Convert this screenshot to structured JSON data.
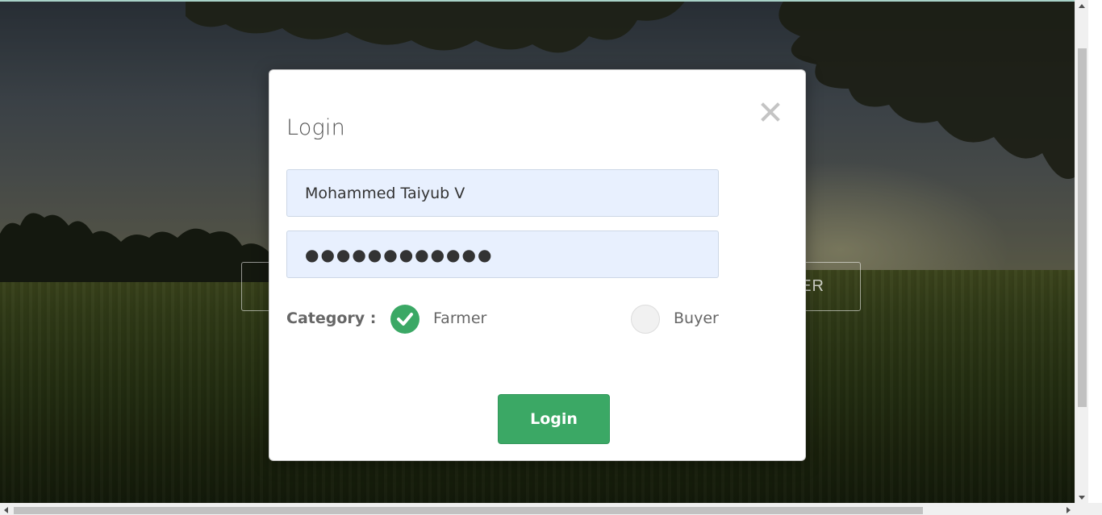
{
  "modal": {
    "title": "Login",
    "close_icon": "close-icon",
    "username_value": "Mohammed Taiyub V",
    "password_value": "●●●●●●●●●●●●",
    "category_label": "Category :",
    "options": [
      {
        "label": "Farmer",
        "checked": true
      },
      {
        "label": "Buyer",
        "checked": false
      }
    ],
    "login_label": "Login"
  },
  "background": {
    "right_button_label": "ER"
  },
  "colors": {
    "accent": "#3ba865",
    "input_bg": "#e8f0fe"
  }
}
